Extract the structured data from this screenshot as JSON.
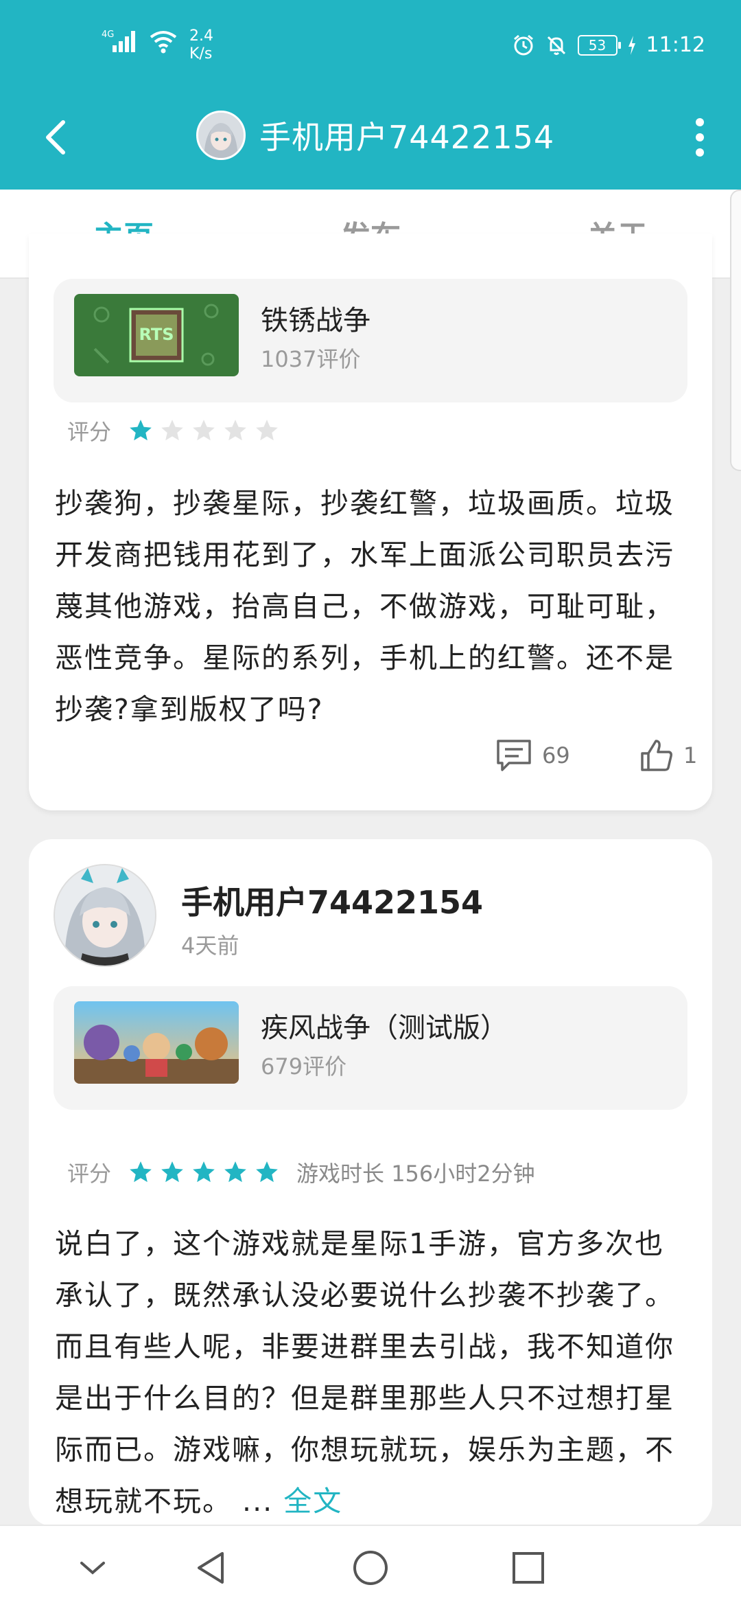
{
  "status_bar": {
    "network": "4G",
    "net_speed_value": "2.4",
    "net_speed_unit": "K/s",
    "battery": "53",
    "time": "11:12"
  },
  "header": {
    "title": "手机用户74422154"
  },
  "tabs": [
    {
      "label": "主页"
    },
    {
      "label": "发布"
    },
    {
      "label": "关于"
    }
  ],
  "reviews": [
    {
      "game": {
        "name": "铁锈战争",
        "reviews": "1037评价",
        "thumb_text": "RTS"
      },
      "rating_label": "评分",
      "stars": 1,
      "text": "抄袭狗，抄袭星际，抄袭红警，垃圾画质。垃圾开发商把钱用花到了，水军上面派公司职员去污蔑其他游戏，抬高自己，不做游戏，可耻可耻，恶性竞争。星际的系列，手机上的红警。还不是抄袭?拿到版权了吗?",
      "comments": "69",
      "likes": "1"
    },
    {
      "author": "手机用户74422154",
      "time": "4天前",
      "game": {
        "name": "疾风战争（测试版）",
        "reviews": "679评价"
      },
      "rating_label": "评分",
      "stars": 5,
      "playtime": "游戏时长 156小时2分钟",
      "text": "说白了，这个游戏就是星际1手游，官方多次也承认了，既然承认没必要说什么抄袭不抄袭了。而且有些人呢，非要进群里去引战，我不知道你是出于什么目的？但是群里那些人只不过想打星际而已。游戏嘛，你想玩就玩，娱乐为主题，不想玩就不玩。",
      "ellipsis": "...",
      "more_label": "全文"
    }
  ],
  "colors": {
    "accent": "#22b5c3",
    "star_on": "#22b5c3",
    "star_off": "#e3e3e3"
  }
}
